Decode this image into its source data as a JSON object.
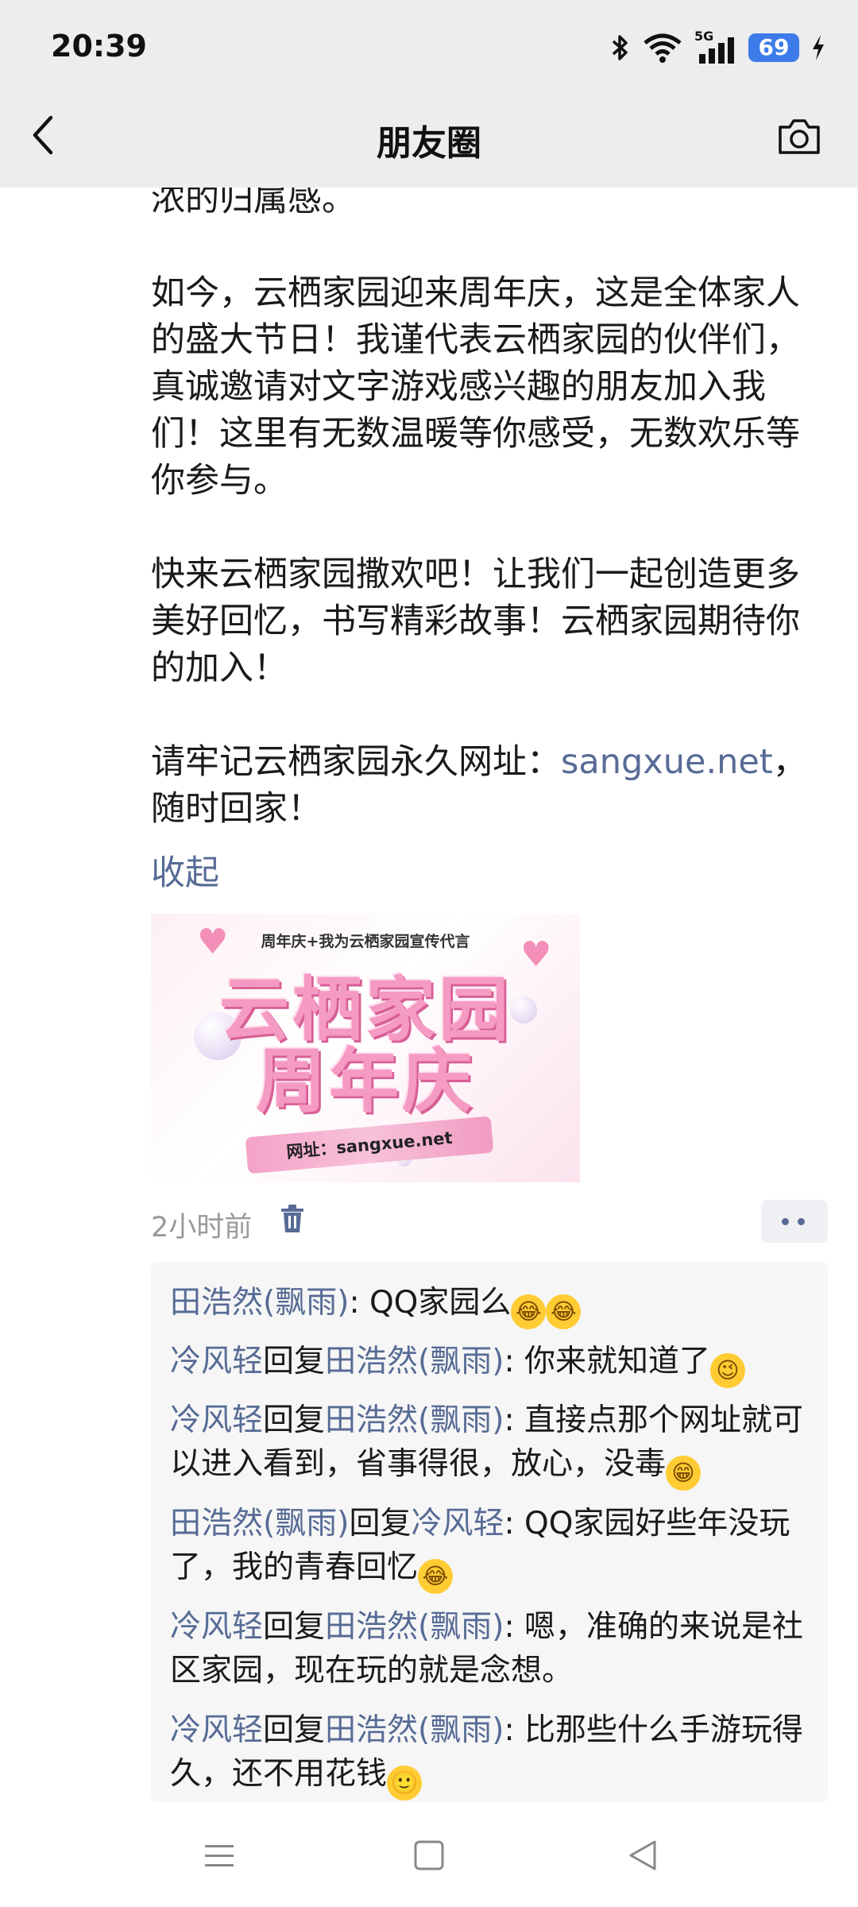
{
  "status_bar": {
    "time": "20:39",
    "icons": [
      "bluetooth-icon",
      "wifi-icon",
      "5g-signal-icon"
    ],
    "network_label": "5G",
    "battery": "69"
  },
  "header": {
    "title": "朋友圈",
    "back_icon": "chevron-left-icon",
    "camera_icon": "camera-icon"
  },
  "post": {
    "paragraphs": [
      "浓的归属感。",
      "如今，云栖家园迎来周年庆，这是全体家人的盛大节日！我谨代表云栖家园的伙伴们，真诚邀请对文字游戏感兴趣的朋友加入我们！这里有无数温暖等你感受，无数欢乐等你参与。",
      "快来云栖家园撒欢吧！让我们一起创造更多美好回忆，书写精彩故事！云栖家园期待你的加入！"
    ],
    "address_prefix": "请牢记云栖家园永久网址：",
    "address_link": "sangxue.net",
    "address_suffix": "，随时回家！",
    "collapse_label": "收起",
    "image": {
      "top_caption": "周年庆+我为云栖家园宣传代言",
      "title_line1": "云栖家园",
      "title_line2": "周年庆",
      "ribbon_text": "网址：sangxue.net"
    },
    "time": "2小时前",
    "accent_color": "#576b95"
  },
  "comments": [
    {
      "author": "田浩然(飘雨)",
      "reply_word": "",
      "reply_to": "",
      "text": ": QQ家园么",
      "emojis": [
        "😂",
        "😂"
      ]
    },
    {
      "author": "冷风轻",
      "reply_word": "回复",
      "reply_to": "田浩然(飘雨)",
      "text": ": 你来就知道了",
      "emojis": [
        "😉"
      ]
    },
    {
      "author": "冷风轻",
      "reply_word": "回复",
      "reply_to": "田浩然(飘雨)",
      "text": ": 直接点那个网址就可以进入看到，省事得很，放心，没毒",
      "emojis": [
        "😁"
      ]
    },
    {
      "author": "田浩然(飘雨)",
      "reply_word": "回复",
      "reply_to": "冷风轻",
      "text": ": QQ家园好些年没玩了，我的青春回忆",
      "emojis": [
        "😂"
      ]
    },
    {
      "author": "冷风轻",
      "reply_word": "回复",
      "reply_to": "田浩然(飘雨)",
      "text": ": 嗯，准确的来说是社区家园，现在玩的就是念想。",
      "emojis": []
    },
    {
      "author": "冷风轻",
      "reply_word": "回复",
      "reply_to": "田浩然(飘雨)",
      "text": ": 比那些什么手游玩得久，还不用花钱",
      "emojis": [
        "🙂"
      ]
    }
  ],
  "bottom_nav": [
    "menu-icon",
    "home-square-icon",
    "back-triangle-icon"
  ]
}
